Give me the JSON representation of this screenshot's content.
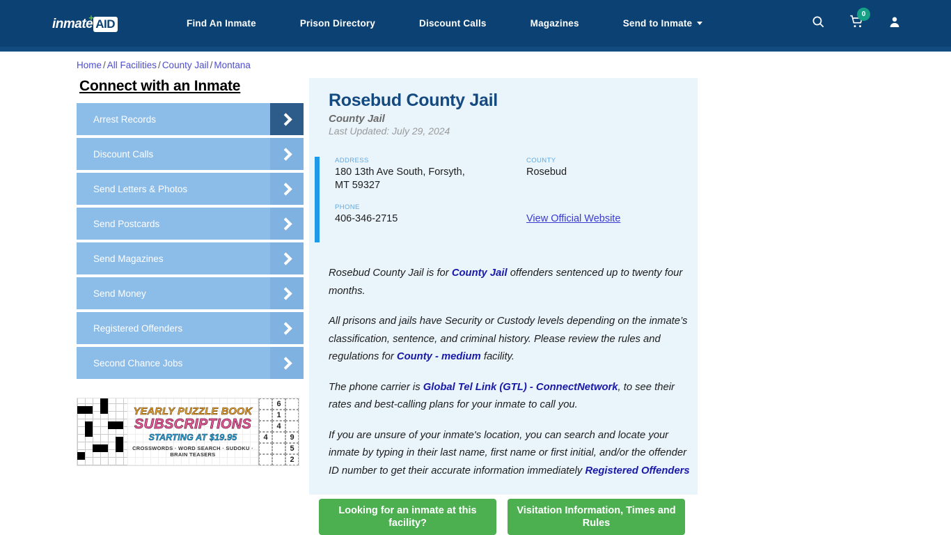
{
  "navbar": {
    "logo": {
      "word": "inmate",
      "box": "AID",
      "cross": "+"
    },
    "links": [
      {
        "label": "Find An Inmate",
        "dropdown": false
      },
      {
        "label": "Prison Directory",
        "dropdown": false
      },
      {
        "label": "Discount Calls",
        "dropdown": false
      },
      {
        "label": "Magazines",
        "dropdown": false
      },
      {
        "label": "Send to Inmate",
        "dropdown": true
      }
    ],
    "icons": {
      "search": "search-icon",
      "cart": "cart-icon",
      "cart_count": "0",
      "account": "user-icon"
    },
    "colors": {
      "background": "#0c4273",
      "badge": "#16a085"
    }
  },
  "breadcrumb": {
    "items": [
      "Home",
      "All Facilities",
      "County Jail",
      "Montana"
    ],
    "separator": "/"
  },
  "sidebar": {
    "title": "Connect with an Inmate",
    "items": [
      {
        "label": "Arrest Records",
        "active": true
      },
      {
        "label": "Discount Calls",
        "active": false
      },
      {
        "label": "Send Letters & Photos",
        "active": false
      },
      {
        "label": "Send Postcards",
        "active": false
      },
      {
        "label": "Send Magazines",
        "active": false
      },
      {
        "label": "Send Money",
        "active": false
      },
      {
        "label": "Registered Offenders",
        "active": false
      },
      {
        "label": "Second Chance Jobs",
        "active": false
      }
    ]
  },
  "ad": {
    "line1": "YEARLY PUZZLE BOOK",
    "line2": "SUBSCRIPTIONS",
    "line3": "STARTING AT $19.95",
    "line4": "CROSSWORDS · WORD SEARCH · SUDOKU · BRAIN TEASERS",
    "sudoku_cells": [
      "",
      "6",
      "",
      "",
      "1",
      "",
      "",
      "4",
      "",
      "4",
      "",
      "9",
      "",
      "",
      "5",
      "",
      "",
      "2"
    ]
  },
  "facility": {
    "name": "Rosebud County Jail",
    "type": "County Jail",
    "last_updated": "Last Updated: July 29, 2024",
    "address_label": "ADDRESS",
    "address_line1": "180 13th Ave South, Forsyth,",
    "address_line2": "MT 59327",
    "county_label": "COUNTY",
    "county_value": "Rosebud",
    "phone_label": "PHONE",
    "phone_value": "406-346-2715",
    "website_link": "View Official Website"
  },
  "description": {
    "p1_a": "Rosebud County Jail is for ",
    "p1_link": "County Jail",
    "p1_b": " offenders sentenced up to twenty four months.",
    "p2_a": "All prisons and jails have Security or Custody levels depending on the inmate’s classification, sentence, and criminal history. Please review the rules and regulations for ",
    "p2_link": "County - medium",
    "p2_b": " facility.",
    "p3_a": "The phone carrier is ",
    "p3_link": "Global Tel Link (GTL) - ConnectNetwork",
    "p3_b": ", to see their rates and best-calling plans for your inmate to call you.",
    "p4_a": "If you are unsure of your inmate's location, you can search and locate your inmate by typing in their last name, first name or first initial, and/or the offender ID number to get their accurate information immediately ",
    "p4_link": "Registered Offenders"
  },
  "cta": {
    "button1": "Looking for an inmate at this facility?",
    "button2": "Visitation Information, Times and Rules",
    "color": "#4caf50"
  }
}
